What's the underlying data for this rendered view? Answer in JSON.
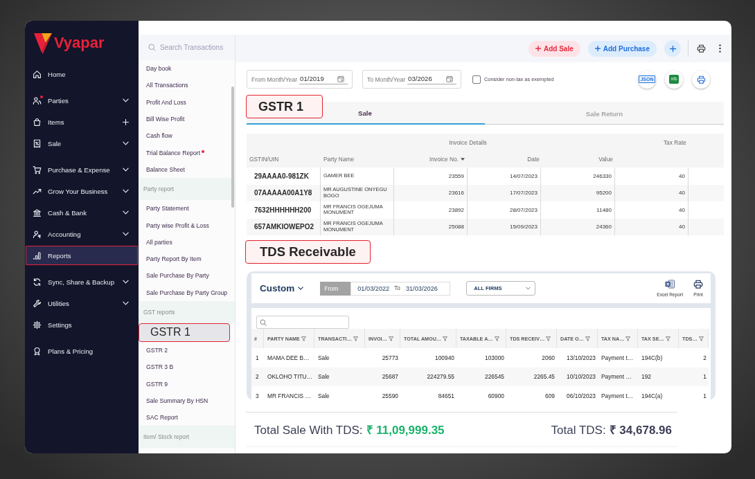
{
  "sidebar": {
    "brand": "Vyapar",
    "groups": [
      {
        "items": [
          {
            "label": "Home",
            "kind": "link",
            "selected": false,
            "alert": false
          }
        ]
      },
      {
        "items": [
          {
            "label": "Parties",
            "kind": "expand",
            "selected": false,
            "alert": true
          },
          {
            "label": "Items",
            "kind": "add",
            "selected": false,
            "alert": false
          },
          {
            "label": "Sale",
            "kind": "expand",
            "selected": false,
            "alert": false
          }
        ]
      },
      {
        "items": [
          {
            "label": "Purchase & Expense",
            "kind": "expand",
            "selected": false,
            "alert": false
          },
          {
            "label": "Grow Your Business",
            "kind": "expand",
            "selected": false,
            "alert": false
          },
          {
            "label": "Cash & Bank",
            "kind": "expand",
            "selected": false,
            "alert": false
          },
          {
            "label": "Accounting",
            "kind": "expand",
            "selected": false,
            "alert": false
          },
          {
            "label": "Reports",
            "kind": "link",
            "selected": true,
            "alert": false
          }
        ]
      },
      {
        "items": [
          {
            "label": "Sync, Share & Backup",
            "kind": "expand",
            "selected": false,
            "alert": false
          },
          {
            "label": "Utilities",
            "kind": "expand",
            "selected": false,
            "alert": false
          },
          {
            "label": "Settings",
            "kind": "link",
            "selected": false,
            "alert": false
          }
        ]
      },
      {
        "items": [
          {
            "label": "Plans & Pricing",
            "kind": "link",
            "selected": false,
            "alert": false
          }
        ]
      }
    ]
  },
  "report_menu": {
    "search": {
      "placeholder": "Search Transactions"
    },
    "sections": [
      {
        "items": [
          {
            "label": "Day book",
            "selected": false,
            "alert": false
          },
          {
            "label": "All Transactions",
            "selected": false,
            "alert": false
          },
          {
            "label": "Profit And Loss",
            "selected": false,
            "alert": false
          },
          {
            "label": "Bill Wise Profit",
            "selected": false,
            "alert": false
          },
          {
            "label": "Cash flow",
            "selected": false,
            "alert": false
          },
          {
            "label": "Trial Balance Report",
            "selected": false,
            "alert": true
          },
          {
            "label": "Balance Sheet",
            "selected": false,
            "alert": false
          }
        ]
      },
      {
        "title": "Party report",
        "items": [
          {
            "label": "Party Statement",
            "selected": false,
            "alert": false
          },
          {
            "label": "Party wise Profit & Loss",
            "selected": false,
            "alert": false
          },
          {
            "label": "All parties",
            "selected": false,
            "alert": false
          },
          {
            "label": "Party Report By Item",
            "selected": false,
            "alert": false
          },
          {
            "label": "Sale Purchase By Party",
            "selected": false,
            "alert": false
          },
          {
            "label": "Sale Purchase By Party Group",
            "selected": false,
            "alert": false
          }
        ]
      },
      {
        "title": "GST reports",
        "items": [
          {
            "label": "GSTR 1",
            "selected": true,
            "alert": false
          },
          {
            "label": "GSTR 2",
            "selected": false,
            "alert": false
          },
          {
            "label": "GSTR 3 B",
            "selected": false,
            "alert": false
          },
          {
            "label": "GSTR 9",
            "selected": false,
            "alert": false
          },
          {
            "label": "Sale Summary By HSN",
            "selected": false,
            "alert": false
          },
          {
            "label": "SAC Report",
            "selected": false,
            "alert": false
          }
        ]
      },
      {
        "title": "Item/ Stock report"
      }
    ]
  },
  "toolbar": {
    "buttons": [
      {
        "kind": "sale",
        "label": "Add Sale"
      },
      {
        "kind": "purchase",
        "label": "Add Purchase"
      }
    ]
  },
  "gstr": {
    "filters": [
      {
        "label": "From Month/Year",
        "value": "01/2019"
      },
      {
        "label": "To Month/Year",
        "value": "03/2026"
      }
    ],
    "exempt": {
      "label": "Consider non-tax as exempted",
      "checked": false
    },
    "exports": [
      {
        "kind": "json",
        "label": "JSON"
      },
      {
        "kind": "xls",
        "label": "xls"
      },
      {
        "kind": "print"
      }
    ],
    "callout": "GSTR 1",
    "tabs": [
      {
        "label": "Sale",
        "selected": true
      },
      {
        "label": "Sale Return",
        "selected": false
      }
    ],
    "table": {
      "column_groups": [
        {
          "label": "Invoice Details"
        },
        {
          "label": "Tax Rate"
        }
      ],
      "columns": [
        {
          "label": "GSTIN/UIN",
          "sorted": false
        },
        {
          "label": "Party Name",
          "sorted": false
        },
        {
          "label": "Invoice No.",
          "sorted": true
        },
        {
          "label": "Date",
          "sorted": false
        },
        {
          "label": "Value",
          "sorted": false
        }
      ],
      "rows": [
        [
          "29AAAA0-981ZK",
          "GAMER BEE",
          "23559",
          "14/07/2023",
          "246330",
          "40"
        ],
        [
          "07AAAAA00A1Y8",
          "MR AUGUSTINE ONYEGU BOGO",
          "23616",
          "17/07/2023",
          "95200",
          "40"
        ],
        [
          "7632HHHHHH200",
          "MR FRANCIS OGEJUMA MONUMENT",
          "23892",
          "28/07/2023",
          "11480",
          "40"
        ],
        [
          "657AMKIOWEPO2",
          "MR FRANCIS OGEJUMA MONUMENT",
          "25088",
          "15/09/2023",
          "24360",
          "40"
        ]
      ]
    }
  },
  "tds": {
    "callout": "TDS Receivable",
    "period": "Custom",
    "range": {
      "from_label": "From",
      "from": "01/03/2022",
      "to_label": "To",
      "to": "31/03/2026"
    },
    "firm": "ALL FIRMS",
    "actions": [
      {
        "kind": "excel",
        "label": "Excel Report"
      },
      {
        "kind": "print",
        "label": "Print"
      }
    ],
    "table": {
      "columns": [
        {
          "label": "#",
          "filterable": false
        },
        {
          "label": "PARTY NAME",
          "filterable": true
        },
        {
          "label": "TRANSACTI…",
          "filterable": true
        },
        {
          "label": "INVOI…",
          "filterable": true
        },
        {
          "label": "TOTAL AMOU…",
          "filterable": true
        },
        {
          "label": "TAXABLE A…",
          "filterable": true
        },
        {
          "label": "TDS RECEIV…",
          "filterable": true
        },
        {
          "label": "DATE O…",
          "filterable": true
        },
        {
          "label": "TAX NA…",
          "filterable": true
        },
        {
          "label": "TAX SE…",
          "filterable": true
        },
        {
          "label": "TDS…",
          "filterable": true
        }
      ],
      "rows": [
        [
          "1",
          "MAMA DEE B…",
          "Sale",
          "25773",
          "100940",
          "103000",
          "2060",
          "13/10/2023",
          "Payment t…",
          "194C(b)",
          "2"
        ],
        [
          "2",
          "OKLOHO TITU…",
          "Sale",
          "25687",
          "224279.55",
          "226545",
          "2265.45",
          "10/10/2023",
          "Payment …",
          "192",
          "1"
        ],
        [
          "3",
          "MR FRANCIS …",
          "Sale",
          "25590",
          "84651",
          "60900",
          "609",
          "06/10/2023",
          "Payment t…",
          "194C(a)",
          "1"
        ]
      ]
    }
  },
  "totals": [
    {
      "kind": "sale",
      "label": "Total Sale With TDS:",
      "value": "₹ 11,09,999.35"
    },
    {
      "kind": "tds",
      "label": "Total TDS:",
      "value": "₹ 34,678.96"
    }
  ]
}
